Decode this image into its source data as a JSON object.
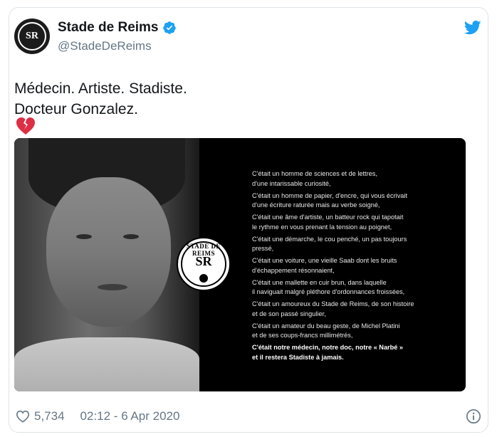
{
  "tweet": {
    "display_name": "Stade de Reims",
    "handle": "@StadeDeReims",
    "verified_icon": "verified-badge-icon",
    "twitter_icon": "twitter-bird-icon",
    "text_line1": "Médecin. Artiste. Stadiste.",
    "text_line2": "Docteur Gonzalez.",
    "emoji": "broken-heart-icon",
    "likes": "5,734",
    "timestamp": "02:12 - 6 Apr 2020",
    "colors": {
      "verified": "#1da1f2",
      "bird": "#1da1f2",
      "emoji": "#dd2e44",
      "muted": "#657786"
    }
  },
  "media": {
    "logo": {
      "top": "STADE DE REIMS",
      "monogram": "SR"
    },
    "poem": [
      "C'était un homme de sciences et de lettres,\nd'une intarissable curiosité,",
      "C'était un homme de papier, d'encre, qui vous écrivait\nd'une écriture raturée mais au verbe soigné,",
      "C'était une âme d'artiste, un batteur rock qui tapotait\nle rythme en vous prenant la tension au poignet,",
      "C'était une démarche, le cou penché, un pas toujours\npressé,",
      "C'était une voiture, une vieille Saab dont les bruits\nd'échappement résonnaient,",
      "C'était une mallette en cuir brun, dans laquelle\nil naviguait malgré pléthore d'ordonnances froissées,",
      "C'était un amoureux du Stade de Reims, de son histoire\net de son passé singulier,",
      "C'était un amateur du beau geste, de Michel Platini\net de ses coups-francs millimétrés,"
    ],
    "poem_closing": "C'était notre médecin, notre doc, notre « Narbé »\net il restera Stadiste à jamais."
  }
}
